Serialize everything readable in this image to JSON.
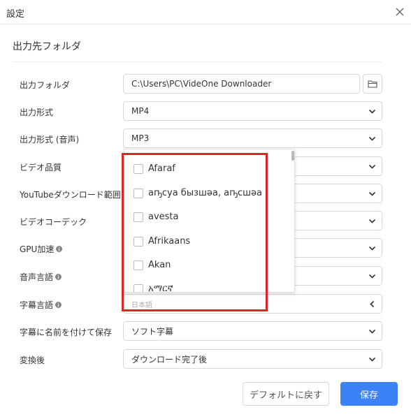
{
  "window": {
    "title": "設定"
  },
  "section": {
    "title": "出力先フォルダ"
  },
  "rows": {
    "output_folder": {
      "label": "出力フォルダ",
      "value": "C:\\Users\\PC\\VideOne Downloader"
    },
    "output_format": {
      "label": "出力形式",
      "value": "MP4"
    },
    "output_format_audio": {
      "label": "出力形式 (音声)",
      "value": "MP3"
    },
    "video_quality": {
      "label": "ビデオ品質",
      "value": ""
    },
    "youtube_range": {
      "label": "YouTubeダウンロード範囲",
      "value": ""
    },
    "video_codec": {
      "label": "ビデオコーデック",
      "value": ""
    },
    "gpu": {
      "label": "GPU加速",
      "value": ""
    },
    "audio_lang": {
      "label": "音声言語",
      "value": ""
    },
    "subtitle_lang": {
      "label": "字幕言語",
      "placeholder": "日本語"
    },
    "save_subtitle": {
      "label": "字幕に名前を付けて保存",
      "value": "ソフト字幕"
    },
    "after_convert": {
      "label": "変換後",
      "value": "ダウンロード完了後"
    }
  },
  "dropdown": {
    "items": [
      "Afaraf",
      "аҧсуа бызшәа, аҧсшәа",
      "avesta",
      "Afrikaans",
      "Akan",
      "አማርኛ"
    ]
  },
  "buttons": {
    "default": "デフォルトに戻す",
    "save": "保存"
  },
  "colors": {
    "accent": "#3b82f6",
    "highlight": "#e0222a"
  },
  "icons": {
    "close": "close-icon",
    "folder": "folder-icon",
    "chevron": "chevron-down-icon",
    "info": "info-icon"
  }
}
